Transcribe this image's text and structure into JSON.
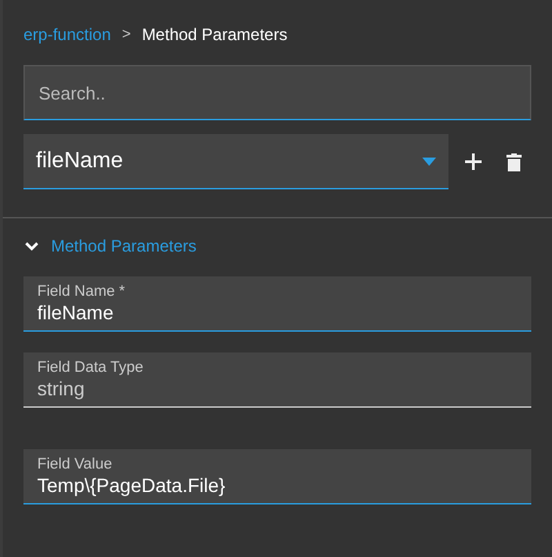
{
  "breadcrumb": [
    {
      "label": "erp-function",
      "kind": "link"
    },
    {
      "label": ">",
      "kind": "separator"
    },
    {
      "label": "Method Parameters",
      "kind": "current"
    }
  ],
  "search": {
    "placeholder": "Search.."
  },
  "method_select": {
    "value": "fileName"
  },
  "section": {
    "title": "Method Parameters",
    "expanded": true
  },
  "fields": [
    {
      "label": "Field Name *",
      "value": "fileName",
      "disabled": false
    },
    {
      "label": "Field Data Type",
      "value": "string",
      "disabled": true
    },
    {
      "label": "Field Value",
      "value": "Temp\\{PageData.File}",
      "disabled": false
    }
  ]
}
